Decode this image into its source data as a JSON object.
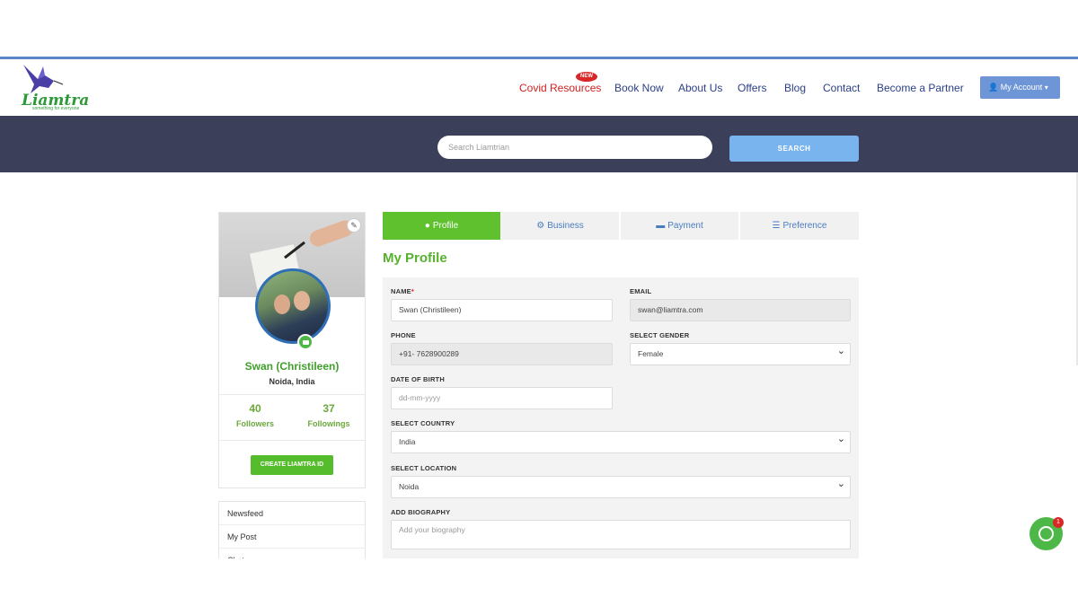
{
  "header": {
    "logo_text": "Liamtra",
    "logo_tagline": "something for everyone",
    "nav": [
      {
        "label": "Covid Resources"
      },
      {
        "label": "Book Now"
      },
      {
        "label": "About Us"
      },
      {
        "label": "Offers"
      },
      {
        "label": "Blog"
      },
      {
        "label": "Contact"
      },
      {
        "label": "Become a Partner"
      }
    ],
    "new_badge": "NEW",
    "account_label": "My Account"
  },
  "search": {
    "placeholder": "Search Liamtrian",
    "button_label": "SEARCH"
  },
  "profile_card": {
    "name": "Swan (Christileen)",
    "location": "Noida, India",
    "followers_count": "40",
    "followers_label": "Followers",
    "followings_count": "37",
    "followings_label": "Followings",
    "create_id_label": "CREATE LIAMTRA ID"
  },
  "side_menu": [
    {
      "label": "Newsfeed"
    },
    {
      "label": "My Post"
    },
    {
      "label": "Chat"
    }
  ],
  "tabs": [
    {
      "label": "Profile",
      "icon": "user-icon"
    },
    {
      "label": "Business",
      "icon": "gear-icon"
    },
    {
      "label": "Payment",
      "icon": "card-icon"
    },
    {
      "label": "Preference",
      "icon": "sliders-icon"
    }
  ],
  "form": {
    "heading": "My Profile",
    "name_label": "NAME",
    "name_required": "*",
    "name_value": "Swan (Christileen)",
    "email_label": "EMAIL",
    "email_value": "swan@liamtra.com",
    "phone_label": "PHONE",
    "phone_value": "+91- 7628900289",
    "gender_label": "SELECT GENDER",
    "gender_value": "Female",
    "dob_label": "DATE OF BIRTH",
    "dob_placeholder": "dd-mm-yyyy",
    "country_label": "SELECT COUNTRY",
    "country_value": "India",
    "location_label": "SELECT LOCATION",
    "location_value": "Noida",
    "bio_label": "ADD BIOGRAPHY",
    "bio_placeholder": "Add your biography"
  },
  "chat": {
    "badge_count": "1"
  },
  "colors": {
    "accent_green": "#5fc12e",
    "nav_blue": "#2b3f86",
    "banner": "#3b3f59",
    "covid_red": "#d32020"
  }
}
